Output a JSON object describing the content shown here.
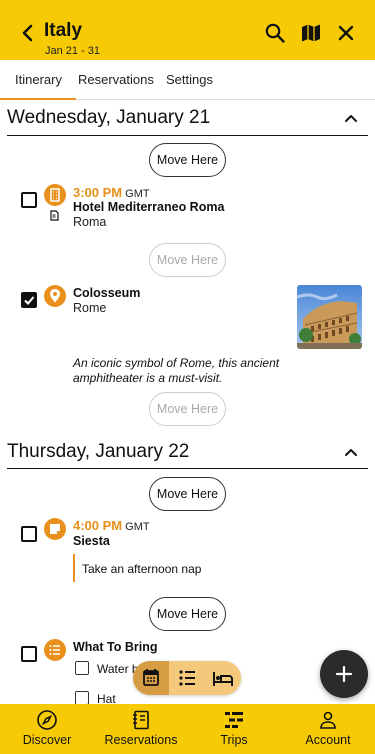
{
  "header": {
    "title": "Italy",
    "dates": "Jan 21 - 31",
    "back_icon": "back-arrow-icon",
    "search_icon": "search-icon",
    "map_icon": "map-icon",
    "close_icon": "close-icon"
  },
  "tabs": [
    {
      "label": "Itinerary",
      "active": true
    },
    {
      "label": "Reservations",
      "active": false
    },
    {
      "label": "Settings",
      "active": false
    }
  ],
  "days": [
    {
      "title": "Wednesday, January 21",
      "items": [
        {
          "move_label": "Move Here",
          "checked": false,
          "icon": "hotel-icon",
          "time": "3:00 PM",
          "tz": "GMT",
          "name": "Hotel Mediterraneo Roma",
          "sub": "Roma",
          "attachment_icon": "document-icon"
        },
        {
          "move_label": "Move Here",
          "checked": true,
          "icon": "location-pin-icon",
          "name": "Colosseum",
          "sub": "Rome",
          "photo_icon": "colosseum-photo",
          "description": "An iconic symbol of Rome, this ancient amphitheater is a must-visit."
        }
      ],
      "trailing_move_label": "Move Here"
    },
    {
      "title": "Thursday, January 22",
      "items": [
        {
          "move_label": "Move Here",
          "checked": false,
          "icon": "note-icon",
          "time": "4:00 PM",
          "tz": "GMT",
          "name": "Siesta",
          "note": "Take an afternoon nap"
        },
        {
          "move_label": "Move Here",
          "checked": false,
          "icon": "list-icon",
          "name": "What To Bring",
          "subitems": [
            "Water b",
            "Hat"
          ]
        }
      ]
    }
  ],
  "view_switcher": [
    {
      "icon": "calendar-icon",
      "active": true
    },
    {
      "icon": "list-view-icon",
      "active": false
    },
    {
      "icon": "bed-icon",
      "active": false
    }
  ],
  "fab_icon": "plus-icon",
  "bottom_nav": [
    {
      "label": "Discover",
      "icon": "compass-icon"
    },
    {
      "label": "Reservations",
      "icon": "notebook-icon"
    },
    {
      "label": "Trips",
      "icon": "trips-icon"
    },
    {
      "label": "Account",
      "icon": "person-icon"
    }
  ],
  "colors": {
    "brand_yellow": "#F6CB05",
    "accent_orange": "#E8901B"
  }
}
